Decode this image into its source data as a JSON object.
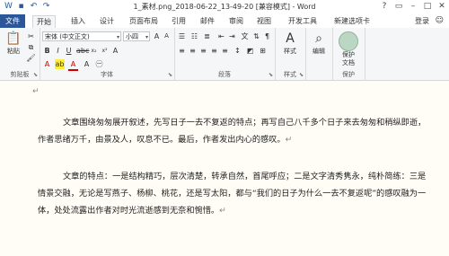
{
  "window": {
    "title": "1_素材.png_2018-06-22_13-49-20 [兼容模式] - Word",
    "user": "登录"
  },
  "tabs": [
    "文件",
    "开始",
    "插入",
    "设计",
    "页面布局",
    "引用",
    "邮件",
    "审阅",
    "视图",
    "开发工具",
    "新建选项卡"
  ],
  "ribbon": {
    "clipboard": {
      "label": "剪贴板",
      "paste": "粘贴"
    },
    "font": {
      "label": "字体",
      "font_name": "宋体 (中文正文)",
      "font_size": "小四"
    },
    "paragraph": {
      "label": "段落"
    },
    "styles": {
      "label": "样式",
      "button": "样式"
    },
    "editing": {
      "button": "编辑"
    },
    "protect": {
      "label": "保护",
      "button": "保护\n文档"
    }
  },
  "document": {
    "paragraphs": [
      "文章围绕匆匆展开叙述，先写日子一去不复返的特点；再写自己八千多个日子来去匆匆和稍纵即逝，作者思绪万千，由景及人，叹息不已。最后，作者发出内心的感叹。",
      "文章的特点：一是结构精巧，层次清楚，转承自然，首尾呼应；二是文字清秀隽永，纯朴简练：三是情景交融，无论是写燕子、杨柳、桃花，还是写太阳，都与“我们的日子为什么一去不复返呢”的感叹融为一体，处处流露出作者对时光流逝感到无奈和惋惜。"
    ],
    "paragraph_mark": "↵"
  },
  "colors": {
    "file_tab": "#2b579a",
    "ribbon_bg": "#f5f6f7",
    "page_bg": "#fffdf6"
  }
}
